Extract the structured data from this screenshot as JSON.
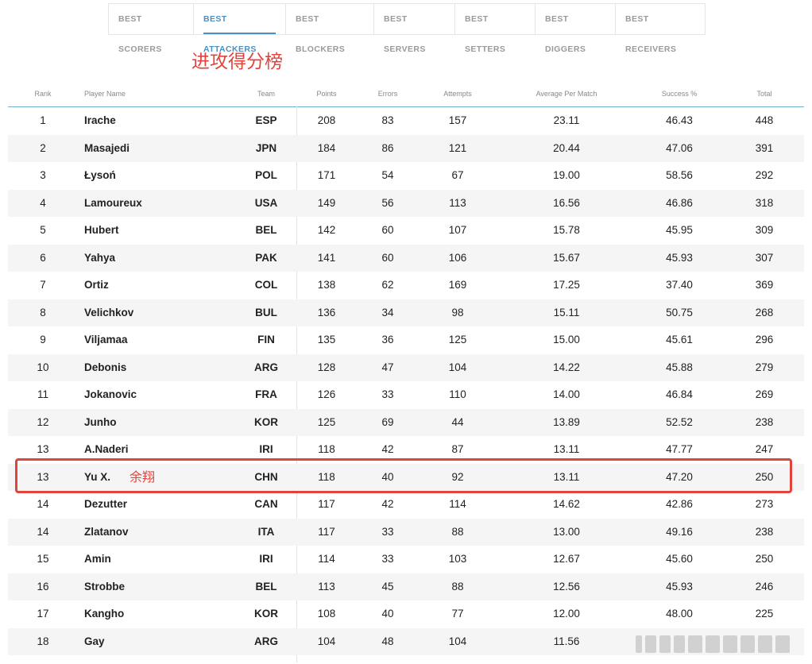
{
  "tabs": [
    {
      "label": "BEST SCORERS",
      "active": false
    },
    {
      "label": "BEST ATTACKERS",
      "active": true
    },
    {
      "label": "BEST BLOCKERS",
      "active": false
    },
    {
      "label": "BEST SERVERS",
      "active": false
    },
    {
      "label": "BEST SETTERS",
      "active": false
    },
    {
      "label": "BEST DIGGERS",
      "active": false
    },
    {
      "label": "BEST RECEIVERS",
      "active": false
    }
  ],
  "annotation": {
    "title": "进攻得分榜",
    "highlight_name": "余翔",
    "highlight_row_index": 13,
    "color": "#e0443c"
  },
  "table": {
    "headers": {
      "rank": "Rank",
      "player": "Player Name",
      "team": "Team",
      "points": "Points",
      "errors": "Errors",
      "attempts": "Attempts",
      "avg": "Average Per Match",
      "success": "Success %",
      "total": "Total"
    },
    "rows": [
      {
        "rank": "1",
        "player": "Irache",
        "team": "ESP",
        "points": "208",
        "errors": "83",
        "attempts": "157",
        "avg": "23.11",
        "success": "46.43",
        "total": "448"
      },
      {
        "rank": "2",
        "player": "Masajedi",
        "team": "JPN",
        "points": "184",
        "errors": "86",
        "attempts": "121",
        "avg": "20.44",
        "success": "47.06",
        "total": "391"
      },
      {
        "rank": "3",
        "player": "Łysoń",
        "team": "POL",
        "points": "171",
        "errors": "54",
        "attempts": "67",
        "avg": "19.00",
        "success": "58.56",
        "total": "292"
      },
      {
        "rank": "4",
        "player": "Lamoureux",
        "team": "USA",
        "points": "149",
        "errors": "56",
        "attempts": "113",
        "avg": "16.56",
        "success": "46.86",
        "total": "318"
      },
      {
        "rank": "5",
        "player": "Hubert",
        "team": "BEL",
        "points": "142",
        "errors": "60",
        "attempts": "107",
        "avg": "15.78",
        "success": "45.95",
        "total": "309"
      },
      {
        "rank": "6",
        "player": "Yahya",
        "team": "PAK",
        "points": "141",
        "errors": "60",
        "attempts": "106",
        "avg": "15.67",
        "success": "45.93",
        "total": "307"
      },
      {
        "rank": "7",
        "player": "Ortiz",
        "team": "COL",
        "points": "138",
        "errors": "62",
        "attempts": "169",
        "avg": "17.25",
        "success": "37.40",
        "total": "369"
      },
      {
        "rank": "8",
        "player": "Velichkov",
        "team": "BUL",
        "points": "136",
        "errors": "34",
        "attempts": "98",
        "avg": "15.11",
        "success": "50.75",
        "total": "268"
      },
      {
        "rank": "9",
        "player": "Viljamaa",
        "team": "FIN",
        "points": "135",
        "errors": "36",
        "attempts": "125",
        "avg": "15.00",
        "success": "45.61",
        "total": "296"
      },
      {
        "rank": "10",
        "player": "Debonis",
        "team": "ARG",
        "points": "128",
        "errors": "47",
        "attempts": "104",
        "avg": "14.22",
        "success": "45.88",
        "total": "279"
      },
      {
        "rank": "11",
        "player": "Jokanovic",
        "team": "FRA",
        "points": "126",
        "errors": "33",
        "attempts": "110",
        "avg": "14.00",
        "success": "46.84",
        "total": "269"
      },
      {
        "rank": "12",
        "player": "Junho",
        "team": "KOR",
        "points": "125",
        "errors": "69",
        "attempts": "44",
        "avg": "13.89",
        "success": "52.52",
        "total": "238"
      },
      {
        "rank": "13",
        "player": "A.Naderi",
        "team": "IRI",
        "points": "118",
        "errors": "42",
        "attempts": "87",
        "avg": "13.11",
        "success": "47.77",
        "total": "247"
      },
      {
        "rank": "13",
        "player": "Yu X.",
        "team": "CHN",
        "points": "118",
        "errors": "40",
        "attempts": "92",
        "avg": "13.11",
        "success": "47.20",
        "total": "250"
      },
      {
        "rank": "14",
        "player": "Dezutter",
        "team": "CAN",
        "points": "117",
        "errors": "42",
        "attempts": "114",
        "avg": "14.62",
        "success": "42.86",
        "total": "273"
      },
      {
        "rank": "14",
        "player": "Zlatanov",
        "team": "ITA",
        "points": "117",
        "errors": "33",
        "attempts": "88",
        "avg": "13.00",
        "success": "49.16",
        "total": "238"
      },
      {
        "rank": "15",
        "player": "Amin",
        "team": "IRI",
        "points": "114",
        "errors": "33",
        "attempts": "103",
        "avg": "12.67",
        "success": "45.60",
        "total": "250"
      },
      {
        "rank": "16",
        "player": "Strobbe",
        "team": "BEL",
        "points": "113",
        "errors": "45",
        "attempts": "88",
        "avg": "12.56",
        "success": "45.93",
        "total": "246"
      },
      {
        "rank": "17",
        "player": "Kangho",
        "team": "KOR",
        "points": "108",
        "errors": "40",
        "attempts": "77",
        "avg": "12.00",
        "success": "48.00",
        "total": "225"
      },
      {
        "rank": "18",
        "player": "Gay",
        "team": "ARG",
        "points": "104",
        "errors": "48",
        "attempts": "104",
        "avg": "11.56",
        "success": "",
        "total": ""
      }
    ]
  },
  "colors": {
    "accent": "#4a90c2",
    "header_rule": "#6fb3c4",
    "annotation_red": "#e0443c",
    "row_alt": "#f5f5f5"
  }
}
